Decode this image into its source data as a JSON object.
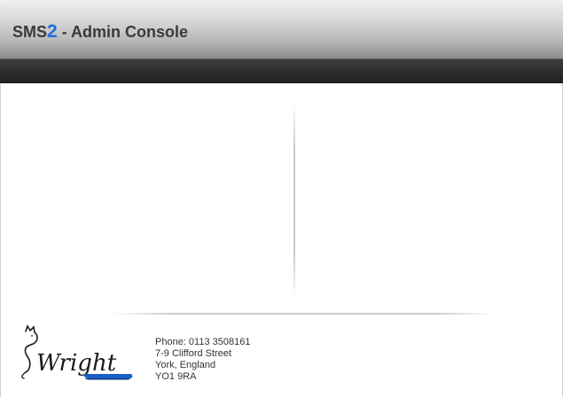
{
  "header": {
    "title_prefix": "SMS",
    "title_accent": "2",
    "title_suffix": " - Admin Console"
  },
  "footer": {
    "logo_text": "Wright",
    "contact": {
      "phone": "Phone: 0113 3508161",
      "street": "7-9 Clifford Street",
      "city": "York, England",
      "postcode": "YO1 9RA"
    }
  },
  "colors": {
    "accent": "#1e6fdc",
    "title_text": "#3a3a3a",
    "header_dark": "#1f1f1f"
  },
  "icons": {
    "logo": "wright-cat-logo-icon"
  }
}
